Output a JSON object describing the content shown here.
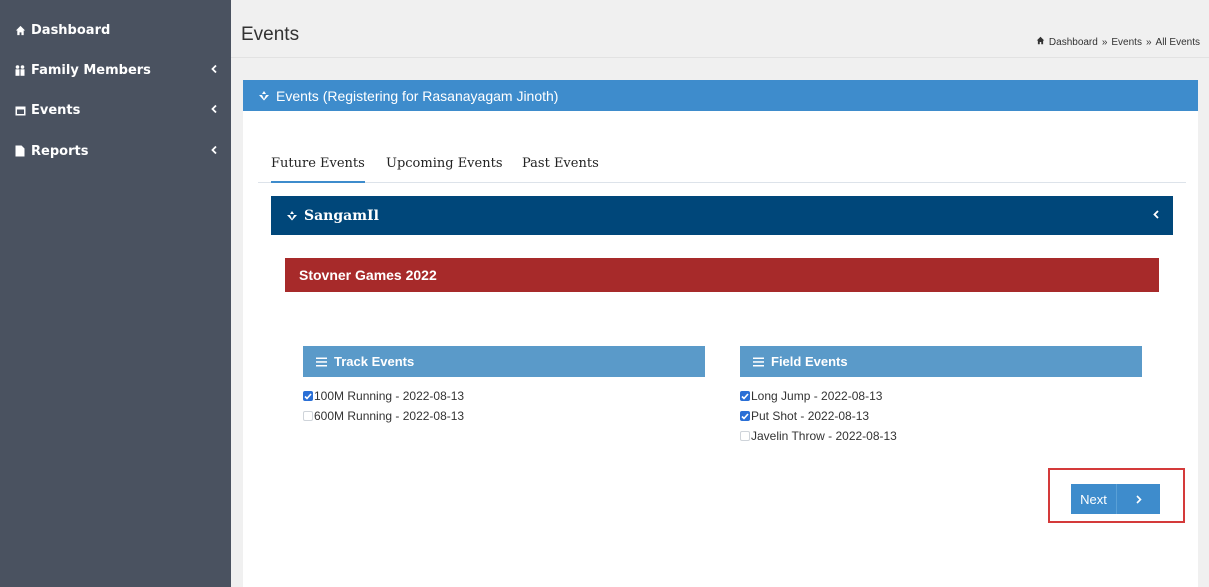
{
  "sidebar": {
    "items": [
      {
        "label": "Dashboard",
        "icon": "home-icon"
      },
      {
        "label": "Family Members",
        "icon": "users-icon"
      },
      {
        "label": "Events",
        "icon": "calendar-icon"
      },
      {
        "label": "Reports",
        "icon": "document-icon"
      }
    ]
  },
  "header": {
    "title": "Events",
    "breadcrumb": [
      "Dashboard",
      "Events",
      "All Events"
    ]
  },
  "card": {
    "title": "Events (Registering for Rasanayagam Jinoth)"
  },
  "tabs": [
    {
      "label": "Future Events",
      "active": true
    },
    {
      "label": "Upcoming Events",
      "active": false
    },
    {
      "label": "Past Events",
      "active": false
    }
  ],
  "group": {
    "title": "SangamIl"
  },
  "event": {
    "title": "Stovner Games 2022"
  },
  "track": {
    "title": "Track Events",
    "items": [
      {
        "label": "100M Running - 2022-08-13",
        "checked": true
      },
      {
        "label": "600M Running - 2022-08-13",
        "checked": false
      }
    ]
  },
  "field": {
    "title": "Field Events",
    "items": [
      {
        "label": "Long Jump - 2022-08-13",
        "checked": true
      },
      {
        "label": "Put Shot - 2022-08-13",
        "checked": true
      },
      {
        "label": "Javelin Throw - 2022-08-13",
        "checked": false
      }
    ]
  },
  "next_button": {
    "label": "Next"
  },
  "colors": {
    "sidebar": "#4a5260",
    "primary": "#3e8ccc",
    "group_header": "#00477a",
    "event_bar": "#a72a2a",
    "section_header": "#5a9ac9",
    "highlight": "#d43a3a"
  }
}
